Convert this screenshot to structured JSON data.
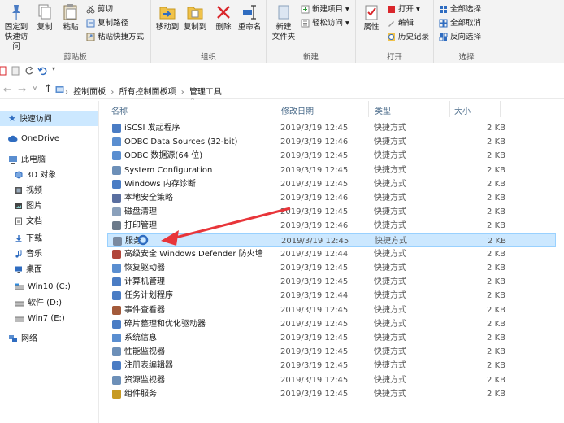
{
  "ribbon": {
    "clipboard": {
      "title": "剪贴板",
      "pin_line1": "固定到",
      "pin_line2": "快速访问",
      "copy": "复制",
      "paste": "粘贴",
      "cut": "剪切",
      "copy_path": "复制路径",
      "paste_shortcut": "粘贴快捷方式"
    },
    "organize": {
      "title": "组织",
      "move_to": "移动到",
      "copy_to": "复制到",
      "delete": "删除",
      "rename": "重命名"
    },
    "new": {
      "title": "新建",
      "new_folder_line1": "新建",
      "new_folder_line2": "文件夹",
      "new_item": "新建项目",
      "easy_access": "轻松访问"
    },
    "open": {
      "title": "打开",
      "properties": "属性",
      "open": "打开",
      "edit": "编辑",
      "history": "历史记录"
    },
    "select": {
      "title": "选择",
      "select_all": "全部选择",
      "select_none": "全部取消",
      "invert": "反向选择"
    }
  },
  "address": {
    "crumbs": [
      "控制面板",
      "所有控制面板项",
      "管理工具"
    ]
  },
  "sidebar": {
    "items": [
      {
        "label": "快速访问",
        "icon": "star-icon"
      },
      {
        "label": "OneDrive",
        "icon": "cloud-icon"
      },
      {
        "label": "此电脑",
        "icon": "computer-icon"
      },
      {
        "label": "3D 对象",
        "icon": "cube-icon"
      },
      {
        "label": "视频",
        "icon": "video-icon"
      },
      {
        "label": "图片",
        "icon": "picture-icon"
      },
      {
        "label": "文档",
        "icon": "document-icon"
      },
      {
        "label": "下载",
        "icon": "download-icon"
      },
      {
        "label": "音乐",
        "icon": "music-icon"
      },
      {
        "label": "桌面",
        "icon": "desktop-icon"
      },
      {
        "label": "Win10 (C:)",
        "icon": "drive-icon"
      },
      {
        "label": "软件 (D:)",
        "icon": "drive-icon"
      },
      {
        "label": "Win7 (E:)",
        "icon": "drive-icon"
      },
      {
        "label": "网络",
        "icon": "network-icon"
      }
    ]
  },
  "list": {
    "columns": {
      "name": "名称",
      "date": "修改日期",
      "type": "类型",
      "size": "大小"
    },
    "rows": [
      {
        "name": "iSCSI 发起程序",
        "date": "2019/3/19 12:45",
        "type": "快捷方式",
        "size": "2 KB"
      },
      {
        "name": "ODBC Data Sources (32-bit)",
        "date": "2019/3/19 12:46",
        "type": "快捷方式",
        "size": "2 KB"
      },
      {
        "name": "ODBC 数据源(64 位)",
        "date": "2019/3/19 12:45",
        "type": "快捷方式",
        "size": "2 KB"
      },
      {
        "name": "System Configuration",
        "date": "2019/3/19 12:45",
        "type": "快捷方式",
        "size": "2 KB"
      },
      {
        "name": "Windows 内存诊断",
        "date": "2019/3/19 12:45",
        "type": "快捷方式",
        "size": "2 KB"
      },
      {
        "name": "本地安全策略",
        "date": "2019/3/19 12:46",
        "type": "快捷方式",
        "size": "2 KB"
      },
      {
        "name": "磁盘清理",
        "date": "2019/3/19 12:45",
        "type": "快捷方式",
        "size": "2 KB"
      },
      {
        "name": "打印管理",
        "date": "2019/3/19 12:46",
        "type": "快捷方式",
        "size": "2 KB"
      },
      {
        "name": "服务",
        "date": "2019/3/19 12:45",
        "type": "快捷方式",
        "size": "2 KB"
      },
      {
        "name": "高级安全 Windows Defender 防火墙",
        "date": "2019/3/19 12:44",
        "type": "快捷方式",
        "size": "2 KB"
      },
      {
        "name": "恢复驱动器",
        "date": "2019/3/19 12:45",
        "type": "快捷方式",
        "size": "2 KB"
      },
      {
        "name": "计算机管理",
        "date": "2019/3/19 12:45",
        "type": "快捷方式",
        "size": "2 KB"
      },
      {
        "name": "任务计划程序",
        "date": "2019/3/19 12:44",
        "type": "快捷方式",
        "size": "2 KB"
      },
      {
        "name": "事件查看器",
        "date": "2019/3/19 12:45",
        "type": "快捷方式",
        "size": "2 KB"
      },
      {
        "name": "碎片整理和优化驱动器",
        "date": "2019/3/19 12:45",
        "type": "快捷方式",
        "size": "2 KB"
      },
      {
        "name": "系统信息",
        "date": "2019/3/19 12:45",
        "type": "快捷方式",
        "size": "2 KB"
      },
      {
        "name": "性能监视器",
        "date": "2019/3/19 12:45",
        "type": "快捷方式",
        "size": "2 KB"
      },
      {
        "name": "注册表编辑器",
        "date": "2019/3/19 12:45",
        "type": "快捷方式",
        "size": "2 KB"
      },
      {
        "name": "资源监视器",
        "date": "2019/3/19 12:45",
        "type": "快捷方式",
        "size": "2 KB"
      },
      {
        "name": "组件服务",
        "date": "2019/3/19 12:45",
        "type": "快捷方式",
        "size": "2 KB"
      }
    ],
    "selected_index": 8
  },
  "colors": {
    "selection": "#cce8ff",
    "annotation_arrow": "#e8353a",
    "header_text": "#4a6b8a"
  }
}
